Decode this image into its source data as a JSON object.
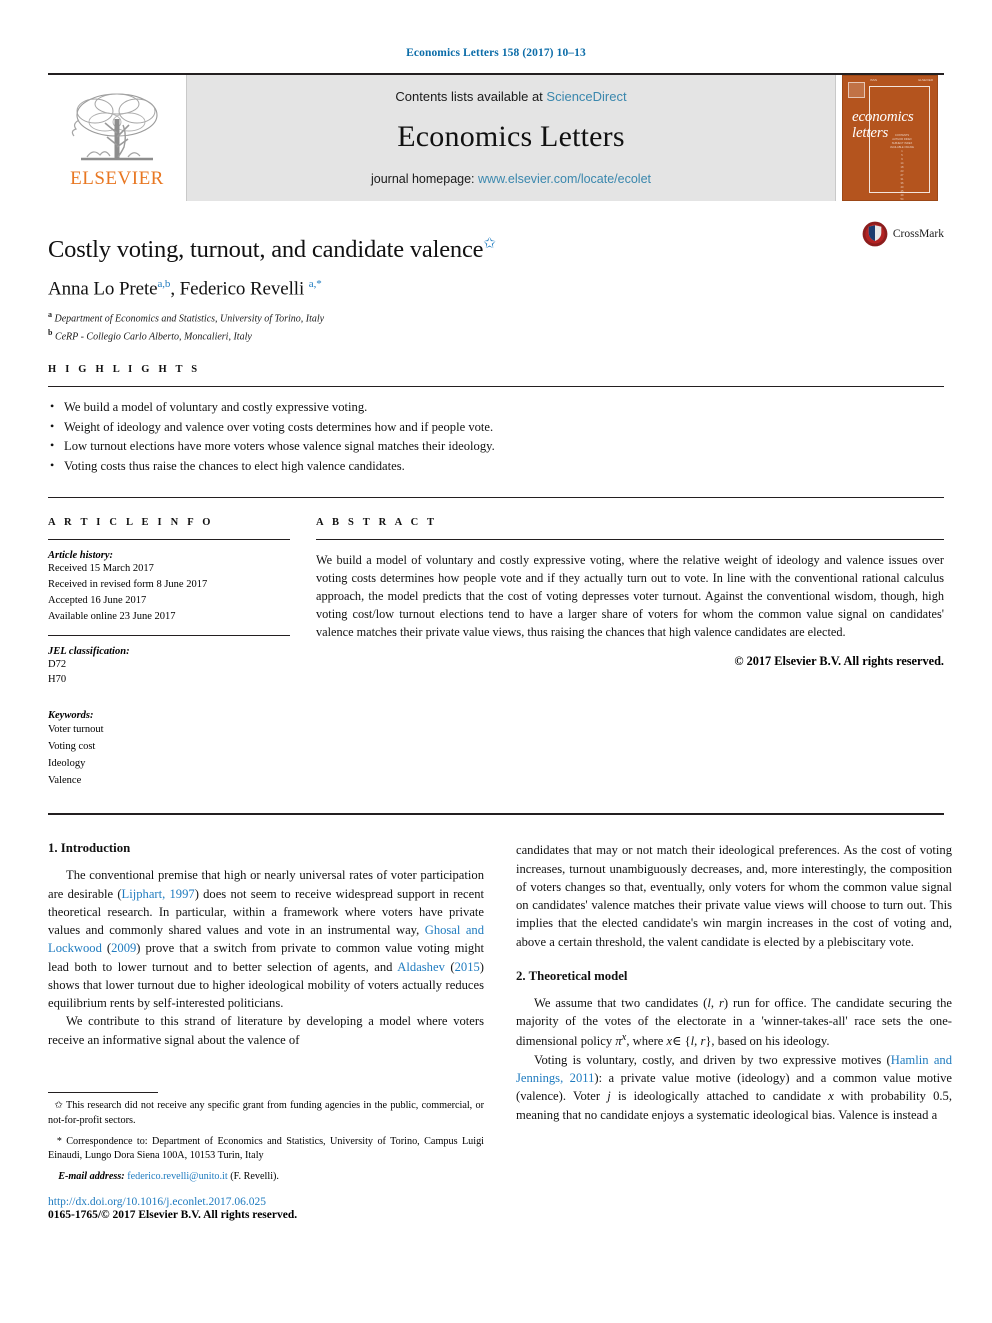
{
  "running_head": "Economics Letters 158 (2017) 10–13",
  "masthead": {
    "publisher_logo_name": "elsevier-tree-logo",
    "publisher_wordmark": "ELSEVIER",
    "contents_prefix": "Contents lists available at ",
    "contents_link": "ScienceDirect",
    "journal_name": "Economics Letters",
    "homepage_prefix": "journal homepage: ",
    "homepage_link": "www.elsevier.com/locate/ecolet",
    "cover": {
      "title_line1": "economics",
      "title_line2": "letters",
      "top_left": "ISSN",
      "top_right": "ELSEVIER",
      "toc_lines": "CONTENTS\nAUTHOR INDEX\nSUBJECT INDEX\nAVAILABLE ONLINE\n1\n5\n9\n14\n18\n23\n27\n31\n36\n40\n45\n49\n54\n58\n62"
    }
  },
  "article": {
    "title": "Costly voting, turnout, and candidate valence",
    "title_star": "✩",
    "authors": "Anna Lo Prete",
    "author1_sup": "a,b",
    "author2": ", Federico Revelli ",
    "author2_sup": "a,*",
    "affiliations": [
      {
        "marker": "a",
        "text": "Department of Economics and Statistics, University of Torino, Italy"
      },
      {
        "marker": "b",
        "text": "CeRP - Collegio Carlo Alberto, Moncalieri, Italy"
      }
    ],
    "crossmark_label": "CrossMark"
  },
  "highlights": {
    "label": "H I G H L I G H T S",
    "items": [
      "We build a model of voluntary and costly expressive voting.",
      "Weight of ideology and valence over voting costs determines how and if people vote.",
      "Low turnout elections have more voters whose valence signal matches their ideology.",
      "Voting costs thus raise the chances to elect high valence candidates."
    ]
  },
  "article_info": {
    "label": "A R T I C L E    I N F O",
    "history_head": "Article history:",
    "history": [
      "Received 15 March 2017",
      "Received in revised form 8 June 2017",
      "Accepted 16 June 2017",
      "Available online 23 June 2017"
    ],
    "jel_head": "JEL classification:",
    "jel": [
      "D72",
      "H70"
    ],
    "keywords_head": "Keywords:",
    "keywords": [
      "Voter turnout",
      "Voting cost",
      "Ideology",
      "Valence"
    ]
  },
  "abstract": {
    "label": "A B S T R A C T",
    "text": "We build a model of voluntary and costly expressive voting, where the relative weight of ideology and valence issues over voting costs determines how people vote and if they actually turn out to vote. In line with the conventional rational calculus approach, the model predicts that the cost of voting depresses voter turnout. Against the conventional wisdom, though, high voting cost/low turnout elections tend to have a larger share of voters for whom the common value signal on candidates' valence matches their private value views, thus raising the chances that high valence candidates are elected.",
    "copyright": "© 2017 Elsevier B.V. All rights reserved."
  },
  "body": {
    "section1_title": "1. Introduction",
    "p1_a": "The conventional premise that high or nearly universal rates of voter participation are desirable (",
    "p1_cite1": "Lijphart, 1997",
    "p1_b": ") does not seem to receive widespread support in recent theoretical research. In particular, within a framework where voters have private values and commonly shared values and vote in an instrumental way, ",
    "p1_cite2": "Ghosal and Lockwood",
    "p1_c": " (",
    "p1_cite2b": "2009",
    "p1_d": ") prove that a switch from private to common value voting might lead both to lower turnout and to better selection of agents, and ",
    "p1_cite3": "Aldashev",
    "p1_e": " (",
    "p1_cite3b": "2015",
    "p1_f": ") shows that lower turnout due to higher ideological mobility of voters actually reduces equilibrium rents by self-interested politicians.",
    "p2": "We contribute to this strand of literature by developing a model where voters receive an informative signal about the valence of",
    "p3": "candidates that may or not match their ideological preferences. As the cost of voting increases, turnout unambiguously decreases, and, more interestingly, the composition of voters changes so that, eventually, only voters for whom the common value signal on candidates' valence matches their private value views will choose to turn out. This implies that the elected candidate's win margin increases in the cost of voting and, above a certain threshold, the valent candidate is elected by a plebiscitary vote.",
    "section2_title": "2. Theoretical model",
    "p4_a": "We assume that two candidates (",
    "p4_i1": "l",
    "p4_b": ", ",
    "p4_i2": "r",
    "p4_c": ") run for office. The candidate securing the majority of the votes of the electorate in a 'winner-takes-all' race sets the one-dimensional policy ",
    "p4_pi": "π",
    "p4_pisup": "x",
    "p4_d": ", where ",
    "p4_x": "x",
    "p4_e": "∈ {",
    "p4_i3": "l",
    "p4_f": ", ",
    "p4_i4": "r",
    "p4_g": "}, based on his ideology.",
    "p5_a": "Voting is voluntary, costly, and driven by two expressive motives (",
    "p5_cite": "Hamlin and Jennings, 2011",
    "p5_b": "): a private value motive (ideology) and a common value motive (valence). Voter ",
    "p5_j": "j",
    "p5_c": " is ideologically attached to candidate ",
    "p5_x": "x",
    "p5_d": " with probability 0.5, meaning that no candidate enjoys a systematic ideological bias. Valence is instead a"
  },
  "footnotes": {
    "fn1_marker": "✩",
    "fn1": "This research did not receive any specific grant from funding agencies in the public, commercial, or not-for-profit sectors.",
    "fn2_marker": "*",
    "fn2": "Correspondence to: Department of Economics and Statistics, University of Torino, Campus Luigi Einaudi, Lungo Dora Siena 100A, 10153 Turin, Italy",
    "email_label": "E-mail address:",
    "email": "federico.revelli@unito.it",
    "email_suffix": " (F. Revelli)."
  },
  "footer": {
    "doi": "http://dx.doi.org/10.1016/j.econlet.2017.06.025",
    "issn": "0165-1765/© 2017 Elsevier B.V. All rights reserved."
  },
  "colors": {
    "link_blue": "#1f7bbf",
    "masthead_blue": "#3a87ad",
    "elsevier_orange": "#e87722",
    "cover_orange": "#b4541e",
    "running_head_blue": "#0b6ca8"
  }
}
